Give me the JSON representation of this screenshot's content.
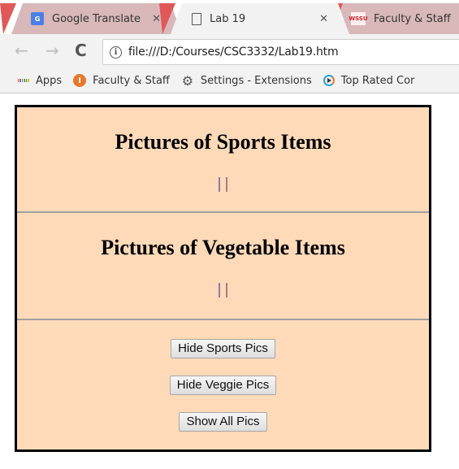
{
  "browser": {
    "tabs": [
      {
        "title": "Google Translate",
        "icon": "google-translate-icon",
        "icon_text": "G",
        "active": false
      },
      {
        "title": "Lab 19",
        "icon": "document-icon",
        "active": true
      },
      {
        "title": "Faculty & Staff",
        "icon": "wssu-icon",
        "icon_text": "WSSU",
        "active": false
      }
    ],
    "close_glyph": "✕",
    "nav": {
      "back": "←",
      "forward": "→",
      "reload": "C"
    },
    "info_glyph": "i",
    "url": "file:///D:/Courses/CSC3332/Lab19.htm",
    "bookmarks": [
      {
        "label": "Apps",
        "icon": "apps-grid-icon"
      },
      {
        "label": "Faculty & Staff",
        "icon": "faculty-staff-icon"
      },
      {
        "label": "Settings - Extensions",
        "icon": "gear-icon"
      },
      {
        "label": "Top Rated Cor",
        "icon": "play-icon"
      }
    ]
  },
  "page": {
    "background": "#ffdab9",
    "sports": {
      "heading": "Pictures of Sports Items"
    },
    "vegetables": {
      "heading": "Pictures of Vegetable Items"
    },
    "buttons": {
      "hide_sports": "Hide Sports Pics",
      "hide_veggie": "Hide Veggie Pics",
      "show_all": "Show All Pics"
    }
  }
}
